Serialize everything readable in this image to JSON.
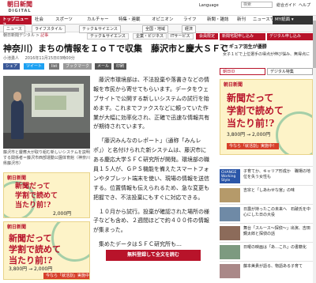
{
  "header": {
    "logo_main": "朝日新聞",
    "logo_sub": "DIGITAL",
    "top_links": [
      "Language",
      "総合ガイド",
      "ヘルプ"
    ],
    "search_placeholder": "検索",
    "home": "トップニュース",
    "categories": [
      "社会",
      "スポーツ",
      "カルチャー",
      "特集・連載",
      "オピニオン",
      "ライフ",
      "新聞・雑誌",
      "新刊",
      "ニュースサーチ",
      "サイエンス"
    ],
    "my_label": "MY紙面 ▾"
  },
  "subnav": [
    "ニュース",
    "ライフスタイル",
    "テック＆サイエンス",
    "全国・地域",
    "経済"
  ],
  "breadcrumb": {
    "parts": [
      "朝日新聞デジタル",
      ">",
      "記事"
    ],
    "selected": "記事"
  },
  "chips": [
    "テック＆サイエンス",
    "企業・ビジネス",
    "ITサービス",
    "会員限定"
  ],
  "article": {
    "title": "神奈川）まちの情報をＩｏＴで収集　藤沢市と慶大ＳＦＣ",
    "byline": "小池勇人",
    "date": "2016年11月15日03時00分",
    "share": [
      {
        "label": "シェア",
        "color": "#3b5998"
      },
      {
        "label": "ツイート",
        "color": "#1da1f2"
      },
      {
        "label": "list",
        "color": "#777"
      },
      {
        "label": "ブックマーク",
        "color": "#999"
      },
      {
        "label": "メール",
        "color": "#555"
      },
      {
        "label": "印刷",
        "color": "#555"
      }
    ],
    "photo_caption": "藤沢市と慶應大が取り組む新しいシステムを説明する関係者＝藤沢市西部運動公園体育館（神奈川県藤沢市）",
    "paragraphs": [
      "藤沢市環境部は、不法投棄や落書きなどの情報を市民から寄せてもらいます。データをウェブサイトで公開する新しいシステムの試行を始めます。これまでファクスなどに頼っていた作業が大幅に効率化され、正確で迅速な情報共有が期待されています。",
      "「藤沢みんなのレポート」（通称「みんレポ」）と名付けられた新システムは、藤沢市にある慶応大学ＳＦＣ研究所が開発。環境部の職員１５人が、ＧＰＳ機能を備えたスマートフォンやタブレット端末を使い、現場の情報を送信する。位置情報も伝えられるため、急な変更も把握でき、不法投棄にもすぐに対応できる。",
      "１０月から試行。投棄が確認された場所の様子なども含め、２週間ほどで約４００件の情報が集まった。",
      "集めたデータはＳＦＣ研究所も…"
    ],
    "read_more": "無料登録して全文を読む"
  },
  "ads": [
    {
      "brand": "朝日新聞",
      "line1": "新聞だって",
      "line2": "学割で読めて",
      "line3": "当たり前!?",
      "price_old": "3,800円",
      "price_new": "2,000円",
      "cta": "今なら「就活割」実施中！"
    },
    {
      "brand": "朝日新聞",
      "line1": "新聞だって",
      "line2": "学割で読めて",
      "line3": "当たり前!?",
      "price_old": "3,800円",
      "price_new": "2,000円",
      "cta": "今なら「就活割」実施中！"
    },
    {
      "brand": "朝日新聞",
      "line1": "新聞だって",
      "line2": "学割で読めて",
      "line3": "当たり前!?",
      "price_old": "3,800円",
      "price_new": "2,000円",
      "cta": "今なら「就活割」実施中！"
    }
  ],
  "sidebar": {
    "buttons": [
      "新聞宅配申し込み",
      "デジタル申し込み"
    ],
    "heading1": "フィギュア羽生が優勝",
    "text1": "女子１ピで上位選手の得点が伸び悩み、無得点に",
    "buttons2": [
      "朝日ID",
      "デジタル特集"
    ],
    "list": [
      {
        "title": "子育てか、キャリア形成か　職場の地位を失う女性も",
        "thumb": "CHANGE Working Style"
      },
      {
        "title": "吉宗と「しあわせな宮」の味",
        "thumb": ""
      },
      {
        "title": "日露が持ったこの未来へ　石破氏を中心にした日の大役",
        "thumb": ""
      },
      {
        "title": "舞台「スルース～探偵～」出演、吉田鋼太郎と探偵の話",
        "thumb": ""
      },
      {
        "title": "日曜の映画は「あ…これ」の書籍化",
        "thumb": ""
      },
      {
        "title": "藤本美貴が語る、物語ある子育て",
        "thumb": ""
      }
    ]
  }
}
